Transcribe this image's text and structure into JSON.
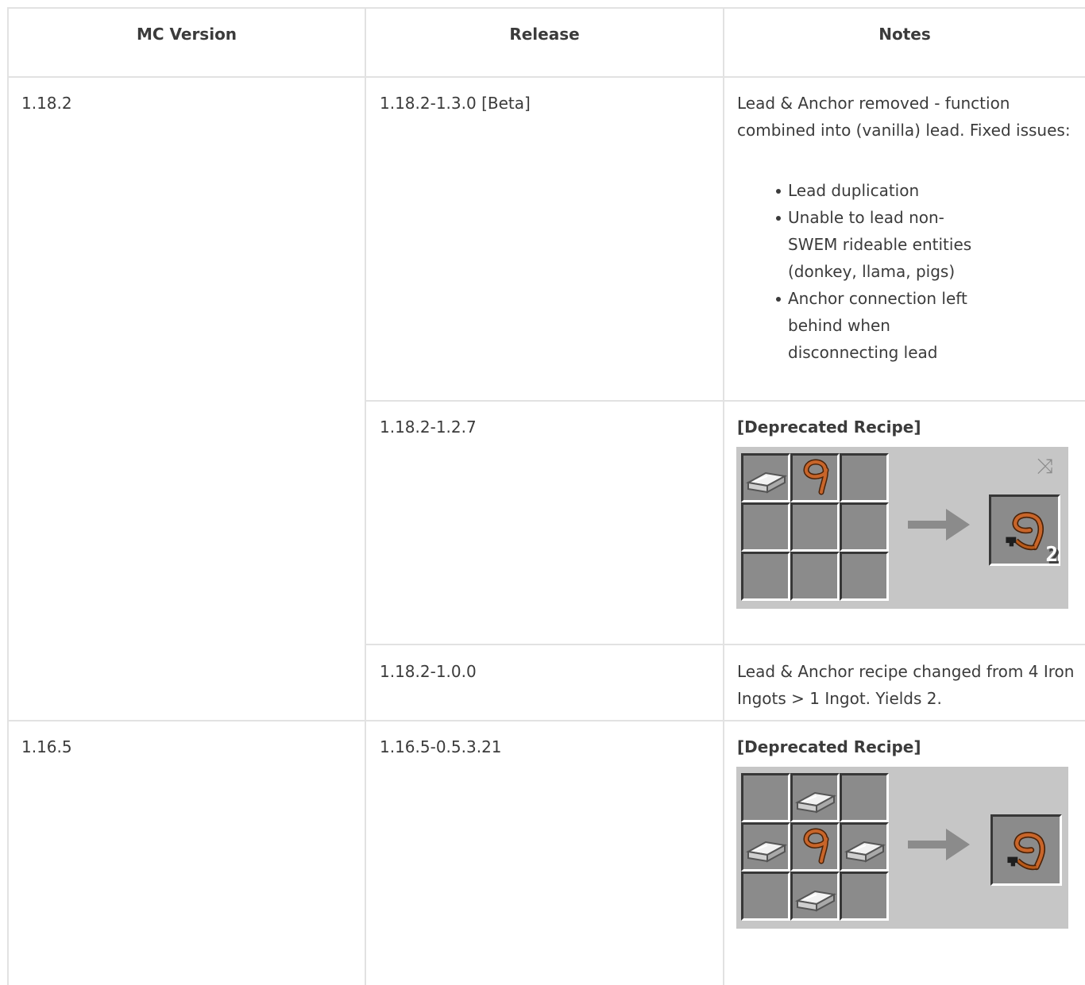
{
  "table": {
    "headers": [
      "MC Version",
      "Release",
      "Notes"
    ],
    "rows": [
      {
        "mc": "1.18.2",
        "release": "1.18.2-1.3.0 [Beta]",
        "notes_text": "Lead & Anchor removed - function combined into (vanilla) lead. Fixed issues:",
        "bullets": [
          "Lead duplication",
          "Unable to lead non-SWEM rideable entities (donkey, llama, pigs)",
          "Anchor connection left behind when disconnecting lead"
        ]
      },
      {
        "release": "1.18.2-1.2.7",
        "notes_heading": "[Deprecated Recipe]",
        "recipe": {
          "grid": [
            "iron-ingot",
            "lead",
            "",
            "",
            "",
            "",
            "",
            "",
            ""
          ],
          "result": "lead-anchor",
          "result_count": "2",
          "shapeless_icon": "shuffle-icon"
        }
      },
      {
        "release": "1.18.2-1.0.0",
        "notes_text": "Lead & Anchor recipe changed from 4 Iron Ingots > 1 Ingot. Yields 2."
      },
      {
        "mc": "1.16.5",
        "release": "1.16.5-0.5.3.21",
        "notes_heading": "[Deprecated Recipe]",
        "recipe": {
          "grid": [
            "",
            "iron-ingot",
            "",
            "iron-ingot",
            "lead",
            "iron-ingot",
            "",
            "iron-ingot",
            ""
          ],
          "result": "lead-anchor",
          "result_count": ""
        }
      }
    ]
  },
  "colors": {
    "border": "#e2e2e2",
    "text": "#3b3b3b",
    "crafting_bg": "#c6c6c6",
    "slot_bg": "#8b8b8b",
    "lead_brown": "#b85a1a"
  }
}
